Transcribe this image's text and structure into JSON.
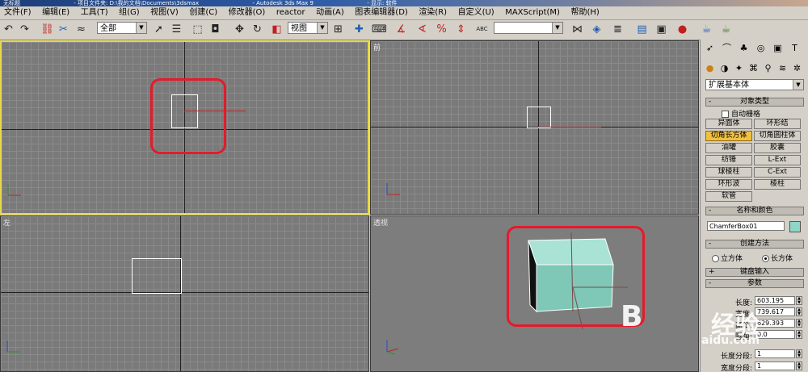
{
  "titlebar": {
    "segments": [
      "无标题",
      "- 项目文件夹: D:\\我的文档\\Documents\\3dsmax",
      "- Autodesk 3ds Max 9",
      "- 显示: 软件"
    ]
  },
  "menu": [
    "文件(F)",
    "编辑(E)",
    "工具(T)",
    "组(G)",
    "视图(V)",
    "创建(C)",
    "修改器(O)",
    "reactor",
    "动画(A)",
    "图表编辑器(D)",
    "渲染(R)",
    "自定义(U)",
    "MAXScript(M)",
    "帮助(H)"
  ],
  "toolbar": {
    "selection_filter": "全部",
    "coord_system": "视图",
    "named_selection": "",
    "abc_label": "ABC"
  },
  "viewports": {
    "top_label": "",
    "front_label": "前",
    "left_label": "左",
    "persp_label": "透视"
  },
  "command_panel": {
    "category": "扩展基本体",
    "object_type": {
      "title": "对象类型",
      "autogrid": "自动栅格",
      "buttons": [
        "异面体",
        "环形结",
        "切角长方体",
        "切角圆柱体",
        "油罐",
        "胶囊",
        "纺锤",
        "L-Ext",
        "球棱柱",
        "C-Ext",
        "环形波",
        "棱柱",
        "软管"
      ],
      "selected": "切角长方体"
    },
    "name_color": {
      "title": "名称和颜色",
      "name": "ChamferBox01",
      "color": "#8ed6c8"
    },
    "creation_method": {
      "title": "创建方法",
      "options": [
        "立方体",
        "长方体"
      ],
      "selected": "长方体"
    },
    "keyboard_entry": "键盘输入",
    "params": {
      "title": "参数",
      "fields": [
        {
          "label": "长度:",
          "value": "603.195"
        },
        {
          "label": "宽度:",
          "value": "739.617"
        },
        {
          "label": "高度:",
          "value": "629.393"
        },
        {
          "label": "圆角:",
          "value": "0.0"
        },
        {
          "label": "长度分段:",
          "value": "1"
        },
        {
          "label": "宽度分段:",
          "value": "1"
        }
      ]
    }
  },
  "watermark": {
    "text": "经验",
    "url": "aidu.com"
  }
}
